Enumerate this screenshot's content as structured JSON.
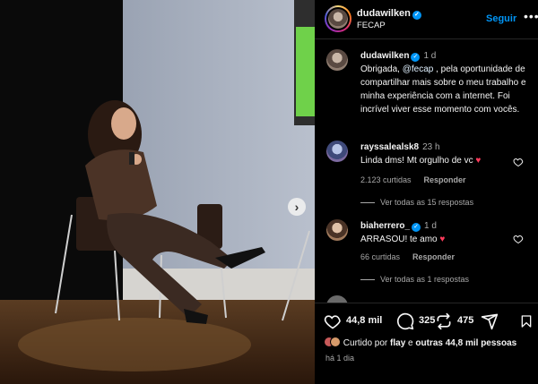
{
  "post_header": {
    "username": "dudawilken",
    "subtitle": "FECAP",
    "follow_label": "Seguir",
    "more_label": "•••"
  },
  "caption": {
    "username": "dudawilken",
    "time": "1 d",
    "text_before": "Obrigada, ",
    "mention": "@fecap",
    "text_after": " , pela oportunidade de compartilhar mais sobre o meu trabalho e minha experiência com a internet. Foi incrível viver esse momento com vocês."
  },
  "comments": [
    {
      "username": "rayssalealsk8",
      "time": "23 h",
      "text": "Linda dms! Mt orgulho de vc",
      "likes": "2.123 curtidas",
      "reply_label": "Responder",
      "see_replies": "Ver todas as 15 respostas"
    },
    {
      "username": "biaherrero_",
      "time": "1 d",
      "text": "ARRASOU! te amo",
      "likes": "66 curtidas",
      "reply_label": "Responder",
      "see_replies": "Ver todas as 1 respostas"
    }
  ],
  "actions": {
    "like_count": "44,8 mil",
    "comment_count": "325",
    "share_count": "475"
  },
  "liked_by": {
    "prefix": "Curtido por",
    "user": "flay",
    "middle": "e",
    "others": "outras 44,8 mil pessoas"
  },
  "posted_ago": "há 1 dia",
  "colors": {
    "accent": "#0095f6",
    "heart": "#ff3040",
    "muted_text": "#a8a8a8"
  }
}
